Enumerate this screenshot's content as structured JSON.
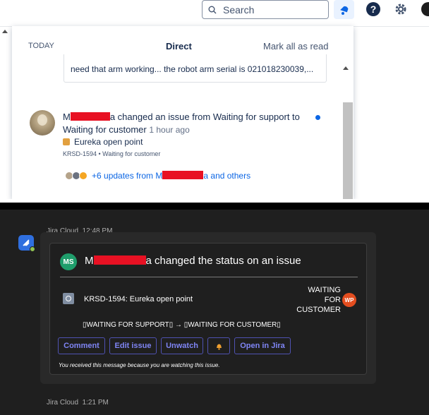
{
  "jira_web": {
    "search": {
      "placeholder": "Search"
    },
    "header": {
      "help_glyph": "?"
    },
    "notifications": {
      "today_label": "TODAY",
      "direct_tab": "Direct",
      "mark_all_read": "Mark all as read",
      "previous_comment_excerpt": "need that arm working... the robot arm serial is 021018230039,...",
      "item": {
        "author_prefix": "M",
        "author_suffix": "a changed an issue from Waiting for support to",
        "line2": "Waiting for customer",
        "time": "1 hour ago",
        "issue_title": "Eureka open point",
        "issue_meta": "KRSD-1594 • Waiting for customer",
        "updates_prefix": "+6 updates from M",
        "updates_suffix": "a and others"
      }
    }
  },
  "teams": {
    "message1": {
      "sender": "Jira Cloud",
      "time": "12:48 PM"
    },
    "card": {
      "avatar_initials": "MS",
      "title_prefix": "M",
      "title_suffix": "a changed the status on an issue",
      "issue": "KRSD-1594: Eureka open point",
      "status_lines": [
        "WAITING",
        "FOR",
        "CUSTOMER"
      ],
      "assignee_initials": "WP",
      "transition": "▯WAITING FOR SUPPORT▯  →  ▯WAITING FOR CUSTOMER▯",
      "buttons": {
        "comment": "Comment",
        "edit": "Edit issue",
        "unwatch": "Unwatch",
        "open": "Open in Jira"
      },
      "footer_note": "You received this message because you are watching this issue."
    },
    "message2": {
      "sender": "Jira Cloud",
      "time": "1:21 PM"
    }
  },
  "colors": {
    "jira_blue": "#0c66e4",
    "redaction": "#e81123",
    "teams_bg": "#1f1f1f",
    "teams_button": "#7f85f5"
  }
}
